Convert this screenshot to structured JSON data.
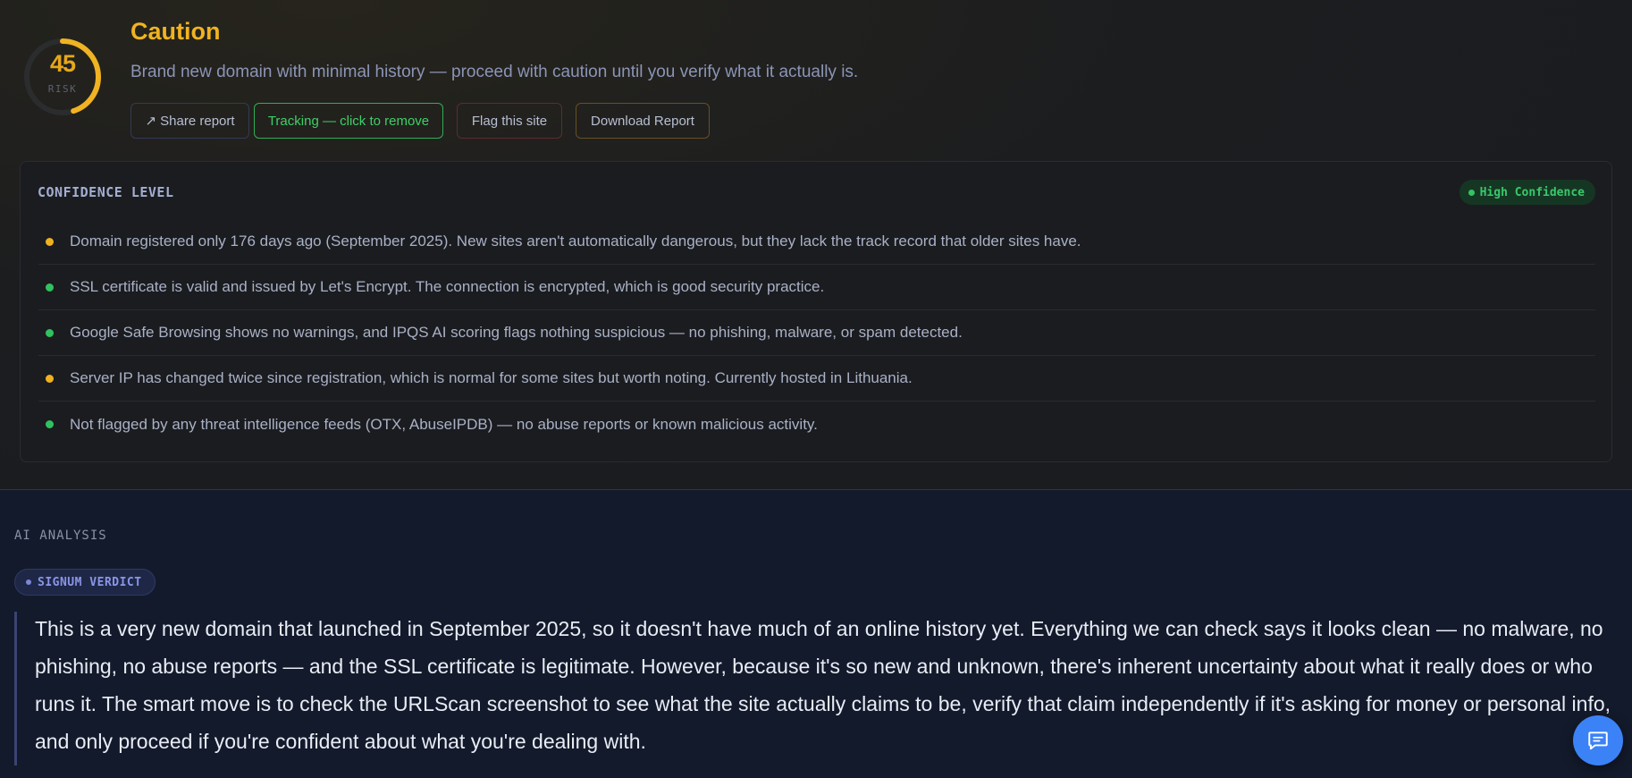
{
  "risk": {
    "score": "45",
    "score_value": 45,
    "label": "RISK",
    "color": "#f0b321"
  },
  "verdict": {
    "title": "Caution",
    "subtitle": "Brand new domain with minimal history — proceed with caution until you verify what it actually is."
  },
  "actions": {
    "share": "↗ Share report",
    "tracking": "Tracking — click to remove",
    "flag": "Flag this site",
    "download": "Download Report"
  },
  "confidence": {
    "title": "CONFIDENCE LEVEL",
    "badge": "High Confidence",
    "findings": [
      {
        "status": "warning",
        "color": "#f1b11f",
        "text": "Domain registered only 176 days ago (September 2025). New sites aren't automatically dangerous, but they lack the track record that older sites have."
      },
      {
        "status": "ok",
        "color": "#2fc25f",
        "text": "SSL certificate is valid and issued by Let's Encrypt. The connection is encrypted, which is good security practice."
      },
      {
        "status": "ok",
        "color": "#2fc25f",
        "text": "Google Safe Browsing shows no warnings, and IPQS AI scoring flags nothing suspicious — no phishing, malware, or spam detected."
      },
      {
        "status": "warning",
        "color": "#f1b11f",
        "text": "Server IP has changed twice since registration, which is normal for some sites but worth noting. Currently hosted in Lithuania."
      },
      {
        "status": "ok",
        "color": "#2fc25f",
        "text": "Not flagged by any threat intelligence feeds (OTX, AbuseIPDB) — no abuse reports or known malicious activity."
      }
    ]
  },
  "ai_analysis": {
    "label": "AI ANALYSIS",
    "pill": "SIGNUM VERDICT",
    "text": "This is a very new domain that launched in September 2025, so it doesn't have much of an online history yet. Everything we can check says it looks clean — no malware, no phishing, no abuse reports — and the SSL certificate is legitimate. However, because it's so new and unknown, there's inherent uncertainty about what it really does or who runs it. The smart move is to check the URLScan screenshot to see what the site actually claims to be, verify that claim independently if it's asking for money or personal info, and only proceed if you're confident about what you're dealing with."
  },
  "chat": {
    "icon": "chat-bubble-icon",
    "color": "#3b82f6"
  }
}
